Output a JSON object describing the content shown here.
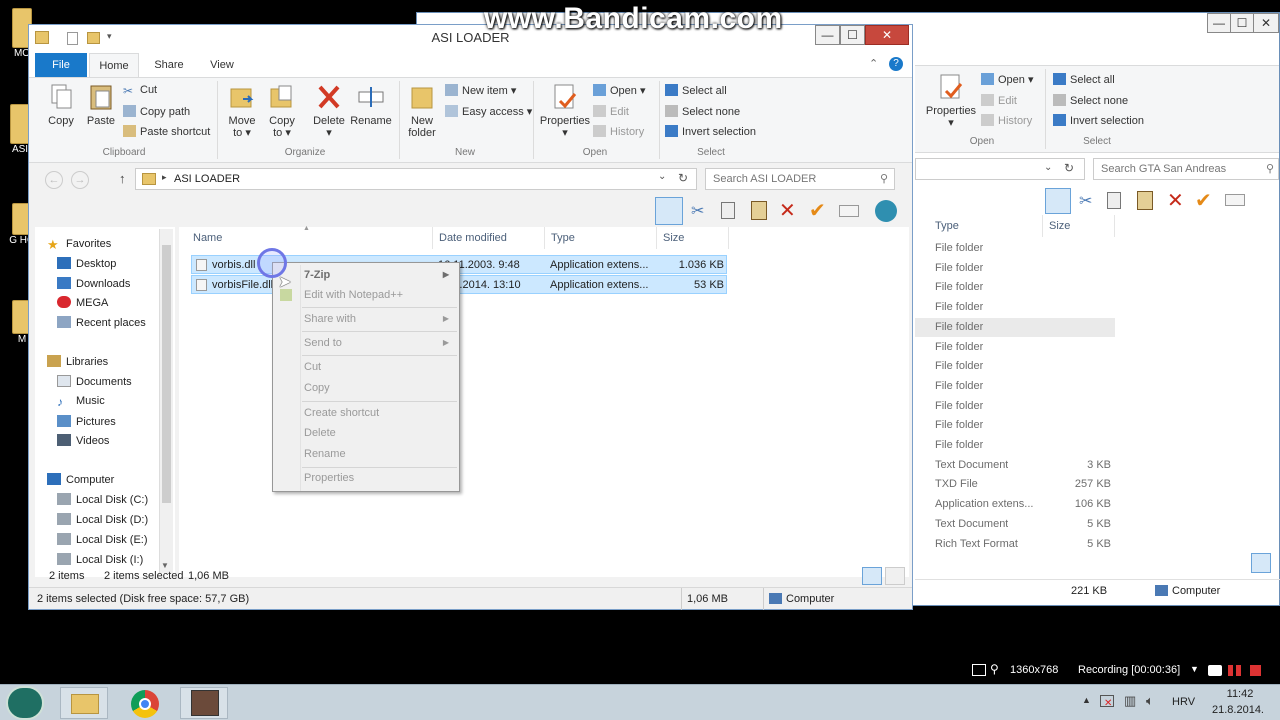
{
  "watermark": "www.Bandicam.com",
  "desktop_labels": [
    "MO",
    "ASI",
    "G HO",
    "M"
  ],
  "main_window": {
    "title": "ASI LOADER",
    "controls": {
      "minimize": "—",
      "maximize": "☐",
      "close": "✕"
    },
    "tabs": [
      "File",
      "Home",
      "Share",
      "View"
    ],
    "ribbon": {
      "clipboard": {
        "label": "Clipboard",
        "copy": "Copy",
        "paste": "Paste",
        "cut": "Cut",
        "copy_path": "Copy path",
        "paste_shortcut": "Paste shortcut"
      },
      "organize": {
        "label": "Organize",
        "move_to": "Move",
        "move_to2": "to ▾",
        "copy_to": "Copy",
        "copy_to2": "to ▾",
        "delete": "Delete",
        "delete2": "▾",
        "rename": "Rename"
      },
      "new": {
        "label": "New",
        "new_folder": "New",
        "new_folder2": "folder",
        "new_item": "New item ▾",
        "easy_access": "Easy access ▾"
      },
      "open": {
        "label": "Open",
        "properties": "Properties",
        "properties2": "▾",
        "open": "Open ▾",
        "edit": "Edit",
        "history": "History"
      },
      "select": {
        "label": "Select",
        "select_all": "Select all",
        "select_none": "Select none",
        "invert_selection": "Invert selection"
      }
    },
    "address": {
      "path": "ASI LOADER",
      "search_placeholder": "Search ASI LOADER"
    },
    "nav": {
      "favorites": "Favorites",
      "desktop": "Desktop",
      "downloads": "Downloads",
      "mega": "MEGA",
      "recent": "Recent places",
      "libraries": "Libraries",
      "documents": "Documents",
      "music": "Music",
      "pictures": "Pictures",
      "videos": "Videos",
      "computer": "Computer",
      "disk_c": "Local Disk (C:)",
      "disk_d": "Local Disk (D:)",
      "disk_e": "Local Disk (E:)",
      "disk_i": "Local Disk (I:)"
    },
    "columns": {
      "name": "Name",
      "date": "Date modified",
      "type": "Type",
      "size": "Size"
    },
    "files": [
      {
        "name": "vorbis.dll",
        "date": "16.11.2003. 9:48",
        "type": "Application extens...",
        "size": "1.036 KB"
      },
      {
        "name": "vorbisFile.dll",
        "date": "26.1.2014. 13:10",
        "type": "Application extens...",
        "size": "53 KB"
      }
    ],
    "context_menu": [
      "7-Zip",
      "Edit with Notepad++",
      "Share with",
      "Send to",
      "Cut",
      "Copy",
      "Create shortcut",
      "Delete",
      "Rename",
      "Properties"
    ],
    "status": {
      "items": "2 items",
      "selected": "2 items selected",
      "size": "1,06 MB"
    },
    "bottom_status": {
      "left": "2 items selected (Disk free space: 57,7 GB)",
      "size": "1,06 MB",
      "location": "Computer"
    }
  },
  "back_window": {
    "ribbon": {
      "properties": "Properties",
      "properties2": "▾",
      "open": "Open ▾",
      "edit": "Edit",
      "history": "History",
      "select_all": "Select all",
      "select_none": "Select none",
      "invert_selection": "Invert selection",
      "open_label": "Open",
      "select_label": "Select"
    },
    "search_placeholder": "Search GTA San Andreas",
    "columns": {
      "type": "Type",
      "size": "Size"
    },
    "rows": [
      {
        "type": "File folder",
        "size": ""
      },
      {
        "type": "File folder",
        "size": ""
      },
      {
        "type": "File folder",
        "size": ""
      },
      {
        "type": "File folder",
        "size": ""
      },
      {
        "type": "File folder",
        "size": ""
      },
      {
        "type": "File folder",
        "size": ""
      },
      {
        "type": "File folder",
        "size": ""
      },
      {
        "type": "File folder",
        "size": ""
      },
      {
        "type": "File folder",
        "size": ""
      },
      {
        "type": "File folder",
        "size": ""
      },
      {
        "type": "File folder",
        "size": ""
      },
      {
        "type": "Text Document",
        "size": "3 KB"
      },
      {
        "type": "TXD File",
        "size": "257 KB"
      },
      {
        "type": "Application extens...",
        "size": "106 KB"
      },
      {
        "type": "Text Document",
        "size": "5 KB"
      },
      {
        "type": "Rich Text Format",
        "size": "5 KB"
      }
    ],
    "status_size": "221 KB",
    "status_location": "Computer"
  },
  "recorder": {
    "resolution": "1360x768",
    "recording": "Recording [00:00:36]"
  },
  "taskbar": {
    "language": "HRV",
    "time": "11:42",
    "date": "21.8.2014."
  }
}
